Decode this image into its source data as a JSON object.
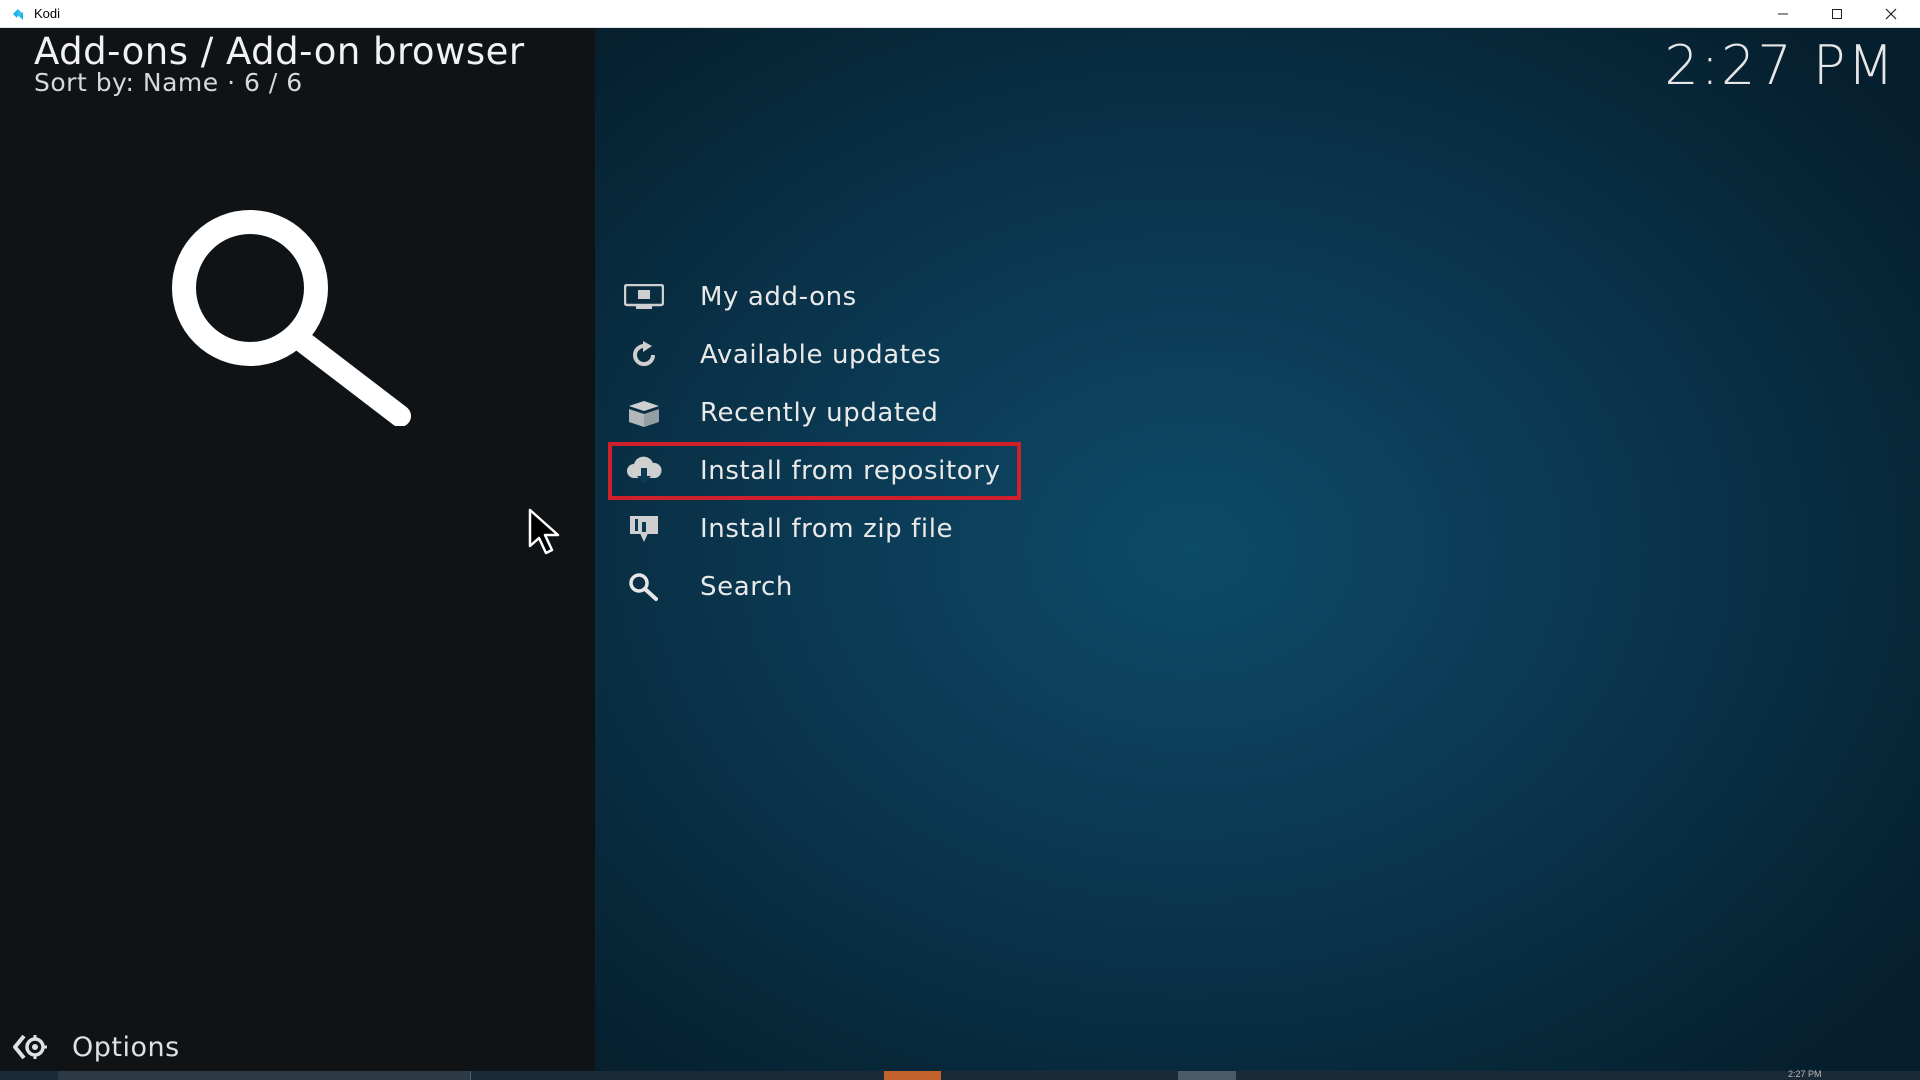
{
  "window": {
    "title": "Kodi"
  },
  "header": {
    "title": "Add-ons / Add-on browser",
    "subtitle": "Sort by: Name  ·  6 / 6",
    "clock": "2:27 PM"
  },
  "menu": {
    "items": [
      {
        "label": "My add-ons",
        "icon": "monitor-box-icon"
      },
      {
        "label": "Available updates",
        "icon": "refresh-icon"
      },
      {
        "label": "Recently updated",
        "icon": "open-box-icon"
      },
      {
        "label": "Install from repository",
        "icon": "cloud-download-icon",
        "highlighted": true
      },
      {
        "label": "Install from zip file",
        "icon": "zip-download-icon"
      },
      {
        "label": "Search",
        "icon": "search-icon"
      }
    ]
  },
  "footer": {
    "options_label": "Options"
  },
  "taskbar": {
    "clock": "2:27 PM"
  },
  "colors": {
    "left_panel": "#101316",
    "right_panel": "#0b3a54",
    "highlight_border": "#d0202c",
    "text": "#e9e9e9"
  }
}
